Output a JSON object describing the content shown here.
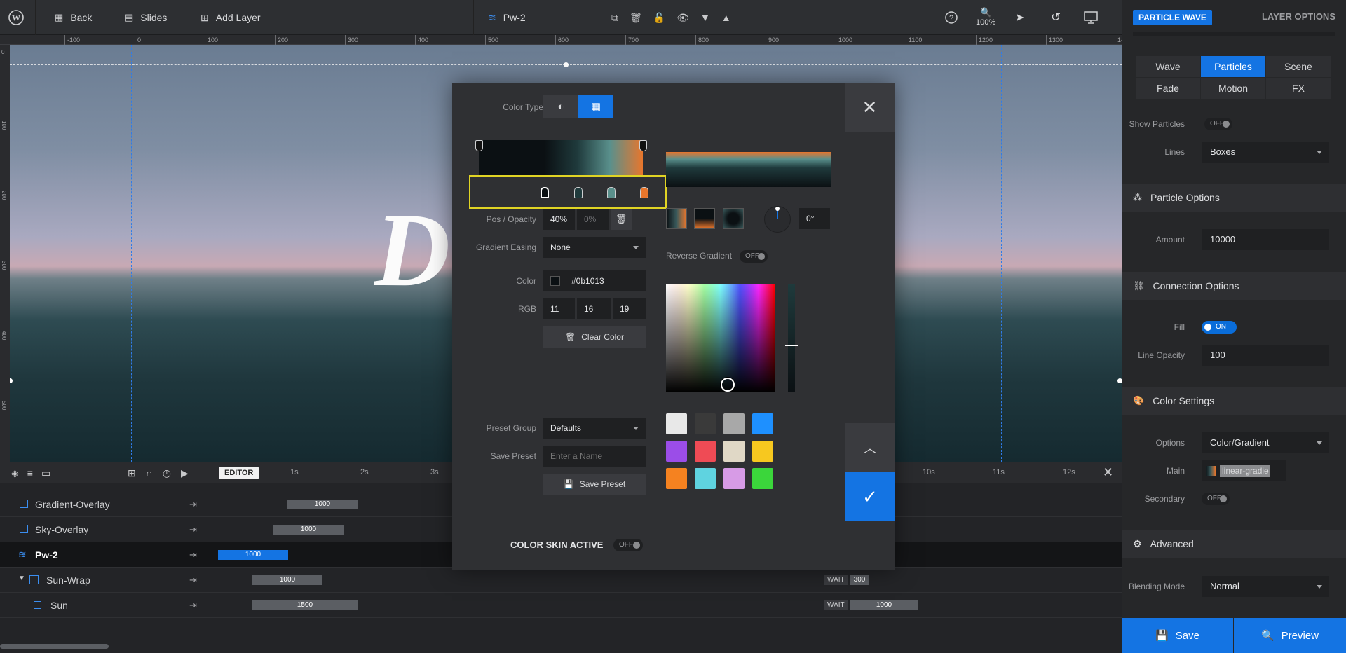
{
  "topbar": {
    "back_label": "Back",
    "slides_label": "Slides",
    "add_layer_label": "Add Layer",
    "layer_name": "Pw-2",
    "zoom": "100%"
  },
  "ruler": {
    "ticks": [
      "-100",
      "0",
      "100",
      "200",
      "300",
      "400",
      "500",
      "600",
      "700",
      "800",
      "900",
      "1000",
      "1100",
      "1200",
      "1300",
      "14"
    ],
    "vticks": [
      "0",
      "100",
      "200",
      "300",
      "400",
      "500"
    ]
  },
  "canvas": {
    "text": "D"
  },
  "timeline": {
    "editor_label": "EDITOR",
    "time_labels": [
      "1s",
      "2s",
      "3s",
      "10s",
      "11s",
      "12s"
    ],
    "rows": [
      {
        "name": "Gradient-Overlay",
        "bar": "1000"
      },
      {
        "name": "Sky-Overlay",
        "bar": "1000"
      },
      {
        "name": "Pw-2",
        "bar": "1000"
      },
      {
        "name": "Sun-Wrap",
        "bar": "1000",
        "wait": "WAIT",
        "wait_val": "300"
      },
      {
        "name": "Sun",
        "bar": "1500",
        "wait": "WAIT",
        "wait_val": "1000"
      }
    ]
  },
  "modal": {
    "color_type_label": "Color Type",
    "pos_opacity_label": "Pos / Opacity",
    "pos_value": "40%",
    "opacity_value": "0%",
    "gradient_easing_label": "Gradient Easing",
    "gradient_easing_value": "None",
    "color_label": "Color",
    "color_hex": "#0b1013",
    "rgb_label": "RGB",
    "rgb": [
      "11",
      "16",
      "19"
    ],
    "clear_color_label": "Clear Color",
    "reverse_gradient_label": "Reverse Gradient",
    "reverse_gradient_state": "OFF",
    "angle_value": "0°",
    "preset_group_label": "Preset Group",
    "preset_group_value": "Defaults",
    "save_preset_label": "Save Preset",
    "save_preset_placeholder": "Enter a Name",
    "save_preset_button": "Save Preset",
    "color_skin_label": "COLOR SKIN ACTIVE",
    "color_skin_state": "OFF",
    "swatches": [
      "#e8e8e8",
      "#3a3a3a",
      "#a8a8a8",
      "#1e90ff",
      "#9b4de8",
      "#ef4b55",
      "#e0d8c6",
      "#f7c81f",
      "#f58220",
      "#5fd3e0",
      "#d79be6",
      "#3bd63b"
    ]
  },
  "panel": {
    "badge": "PARTICLE WAVE",
    "layer_options": "LAYER OPTIONS",
    "tabs": [
      "Wave",
      "Particles",
      "Scene",
      "Fade",
      "Motion",
      "FX"
    ],
    "show_particles_label": "Show Particles",
    "show_particles_state": "OFF",
    "lines_label": "Lines",
    "lines_value": "Boxes",
    "particle_options_title": "Particle Options",
    "amount_label": "Amount",
    "amount_value": "10000",
    "connection_options_title": "Connection Options",
    "fill_label": "Fill",
    "fill_state": "ON",
    "line_opacity_label": "Line Opacity",
    "line_opacity_value": "100",
    "color_settings_title": "Color Settings",
    "options_label": "Options",
    "options_value": "Color/Gradient",
    "main_label": "Main",
    "main_value": "linear-gradie",
    "secondary_label": "Secondary",
    "secondary_state": "OFF",
    "advanced_title": "Advanced",
    "blending_label": "Blending Mode",
    "blending_value": "Normal",
    "save_label": "Save",
    "preview_label": "Preview"
  }
}
